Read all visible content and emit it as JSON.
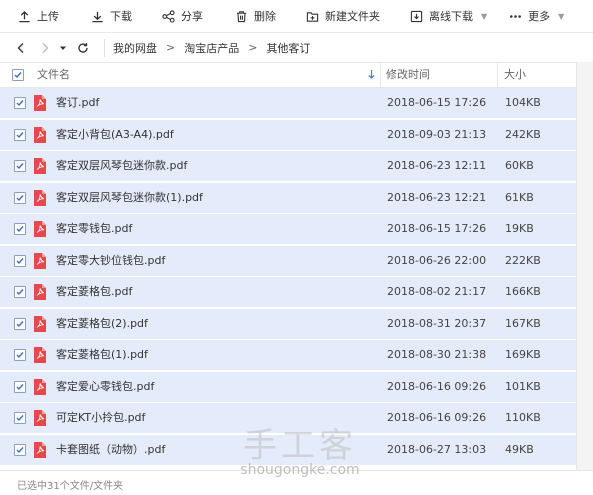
{
  "toolbar": {
    "upload": "上传",
    "download": "下载",
    "share": "分享",
    "delete": "删除",
    "new_folder": "新建文件夹",
    "offline_download": "离线下载",
    "more": "更多"
  },
  "breadcrumb": [
    "我的网盘",
    "淘宝店产品",
    "其他客订"
  ],
  "table": {
    "headers": {
      "name": "文件名",
      "modified": "修改时间",
      "size": "大小"
    },
    "rows": [
      {
        "name": "客订.pdf",
        "modified": "2018-06-15 17:26",
        "size": "104KB"
      },
      {
        "name": "客定小背包(A3-A4).pdf",
        "modified": "2018-09-03 21:13",
        "size": "242KB"
      },
      {
        "name": "客定双层风琴包迷你款.pdf",
        "modified": "2018-06-23 12:11",
        "size": "60KB"
      },
      {
        "name": "客定双层风琴包迷你款(1).pdf",
        "modified": "2018-06-23 12:21",
        "size": "61KB"
      },
      {
        "name": "客定零钱包.pdf",
        "modified": "2018-06-15 17:26",
        "size": "19KB"
      },
      {
        "name": "客定零大钞位钱包.pdf",
        "modified": "2018-06-26 22:00",
        "size": "222KB"
      },
      {
        "name": "客定菱格包.pdf",
        "modified": "2018-08-02 21:17",
        "size": "166KB"
      },
      {
        "name": "客定菱格包(2).pdf",
        "modified": "2018-08-31 20:37",
        "size": "167KB"
      },
      {
        "name": "客定菱格包(1).pdf",
        "modified": "2018-08-30 21:38",
        "size": "169KB"
      },
      {
        "name": "客定爱心零钱包.pdf",
        "modified": "2018-06-16 09:26",
        "size": "101KB"
      },
      {
        "name": "可定KT小拎包.pdf",
        "modified": "2018-06-16 09:26",
        "size": "110KB"
      },
      {
        "name": "卡套图纸（动物）.pdf",
        "modified": "2018-06-27 13:03",
        "size": "49KB"
      }
    ]
  },
  "status": "已选中31个文件/文件夹",
  "watermark": {
    "cn": "手工客",
    "en": "shougongke.com"
  },
  "colors": {
    "selected_row": "#e4ebfb",
    "pdf_red": "#e8474e",
    "sort_arrow": "#3b7ddd"
  }
}
